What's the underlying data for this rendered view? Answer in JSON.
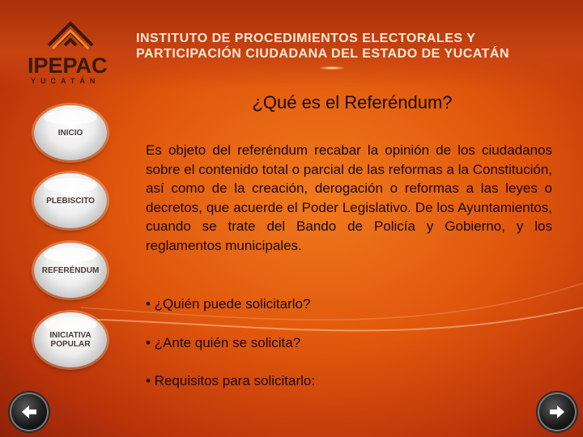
{
  "header": {
    "logo_text": "IPEPAC",
    "logo_sub": "YUCATÁN",
    "institution_line1": "INSTITUTO DE PROCEDIMIENTOS ELECTORALES Y",
    "institution_line2": "PARTICIPACIÓN CIUDADANA DEL ESTADO DE YUCATÁN"
  },
  "nav": {
    "items": [
      {
        "label": "INICIO"
      },
      {
        "label": "PLEBISCITO"
      },
      {
        "label": "REFERÉNDUM"
      },
      {
        "label_line1": "INICIATIVA",
        "label_line2": "POPULAR"
      }
    ],
    "prev_icon": "arrow-left-icon",
    "next_icon": "arrow-right-icon"
  },
  "content": {
    "title": "¿Qué es el Referéndum?",
    "paragraph": "Es objeto del referéndum recabar la opinión de los ciudadanos sobre el contenido total o parcial de las reformas a la Constitución, así como de la creación, derogación o reformas a las leyes o decretos, que acuerde el Poder Legislativo. De los Ayuntamientos, cuando se trate del Bando de Policía y Gobierno, y los reglamentos municipales.",
    "bullets": [
      "• ¿Quién puede solicitarlo?",
      "• ¿Ante quién se solicita?",
      "• Requisitos para solicitarlo:"
    ]
  },
  "colors": {
    "background": "#e0560c",
    "title_text": "#fde9d6",
    "body_text": "#1a0a05"
  }
}
